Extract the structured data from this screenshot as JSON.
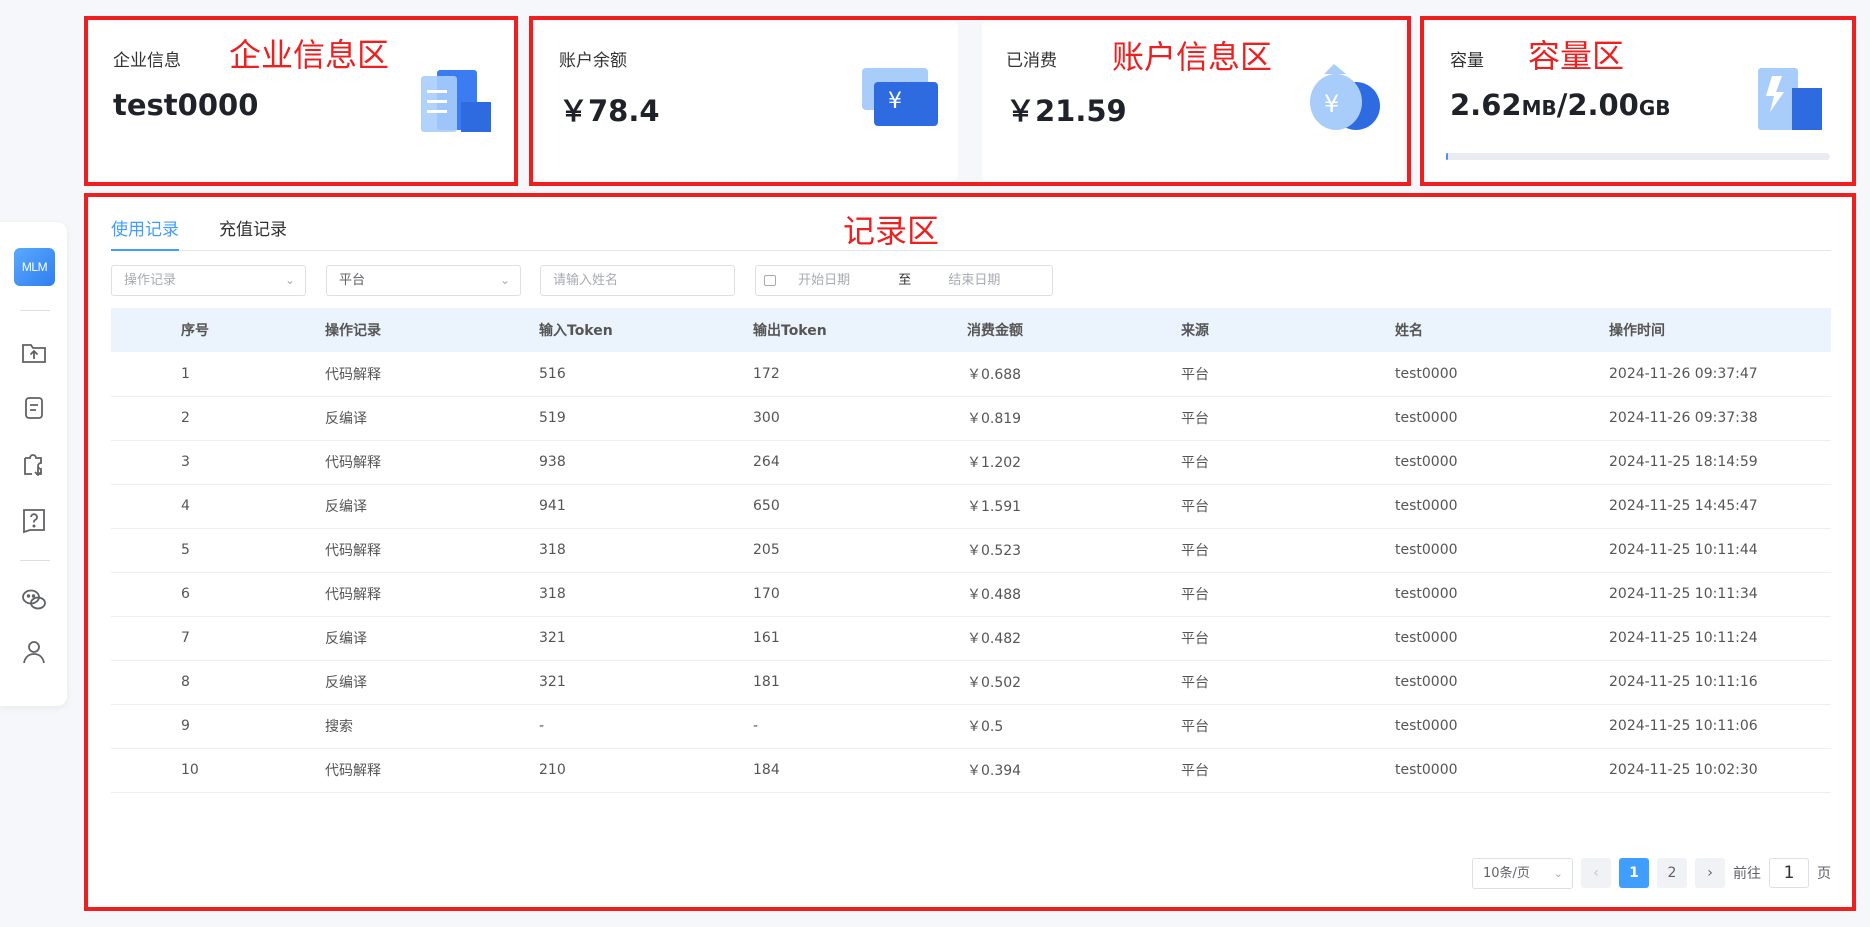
{
  "sidebar": {
    "logo_text": "MLM",
    "icons": [
      "folder-upload-icon",
      "document-icon",
      "puzzle-icon",
      "help-icon",
      "wechat-icon",
      "user-icon"
    ]
  },
  "cards": {
    "company": {
      "label": "企业信息",
      "value": "test0000"
    },
    "balance": {
      "label": "账户余额",
      "value": "￥78.4"
    },
    "consumed": {
      "label": "已消费",
      "value": "￥21.59"
    },
    "capacity": {
      "label": "容量",
      "used": "2.62",
      "used_unit": "MB",
      "separator": "/",
      "total": "2.00",
      "total_unit": "GB",
      "progress_fraction": 0.0013
    }
  },
  "annotations": {
    "company_area": "企业信息区",
    "account_area": "账户信息区",
    "capacity_area": "容量区",
    "records_area": "记录区"
  },
  "tabs": [
    "使用记录",
    "充值记录"
  ],
  "filters": {
    "operation_placeholder": "操作记录",
    "platform_value": "平台",
    "name_placeholder": "请输入姓名",
    "start_date_placeholder": "开始日期",
    "date_separator": "至",
    "end_date_placeholder": "结束日期"
  },
  "table": {
    "headers": [
      "序号",
      "操作记录",
      "输入Token",
      "输出Token",
      "消费金额",
      "来源",
      "姓名",
      "操作时间"
    ],
    "rows": [
      [
        "1",
        "代码解释",
        "516",
        "172",
        "￥0.688",
        "平台",
        "test0000",
        "2024-11-26 09:37:47"
      ],
      [
        "2",
        "反编译",
        "519",
        "300",
        "￥0.819",
        "平台",
        "test0000",
        "2024-11-26 09:37:38"
      ],
      [
        "3",
        "代码解释",
        "938",
        "264",
        "￥1.202",
        "平台",
        "test0000",
        "2024-11-25 18:14:59"
      ],
      [
        "4",
        "反编译",
        "941",
        "650",
        "￥1.591",
        "平台",
        "test0000",
        "2024-11-25 14:45:47"
      ],
      [
        "5",
        "代码解释",
        "318",
        "205",
        "￥0.523",
        "平台",
        "test0000",
        "2024-11-25 10:11:44"
      ],
      [
        "6",
        "代码解释",
        "318",
        "170",
        "￥0.488",
        "平台",
        "test0000",
        "2024-11-25 10:11:34"
      ],
      [
        "7",
        "反编译",
        "321",
        "161",
        "￥0.482",
        "平台",
        "test0000",
        "2024-11-25 10:11:24"
      ],
      [
        "8",
        "反编译",
        "321",
        "181",
        "￥0.502",
        "平台",
        "test0000",
        "2024-11-25 10:11:16"
      ],
      [
        "9",
        "搜索",
        "-",
        "-",
        "￥0.5",
        "平台",
        "test0000",
        "2024-11-25 10:11:06"
      ],
      [
        "10",
        "代码解释",
        "210",
        "184",
        "￥0.394",
        "平台",
        "test0000",
        "2024-11-25 10:02:30"
      ]
    ]
  },
  "pagination": {
    "page_size": "10条/页",
    "pages": [
      "1",
      "2"
    ],
    "current_page": "1",
    "goto_label": "前往",
    "goto_value": "1",
    "page_suffix": "页",
    "prev": "‹",
    "next": "›"
  },
  "colors": {
    "accent": "#409eff",
    "annotation_red": "#ee1f1f"
  }
}
